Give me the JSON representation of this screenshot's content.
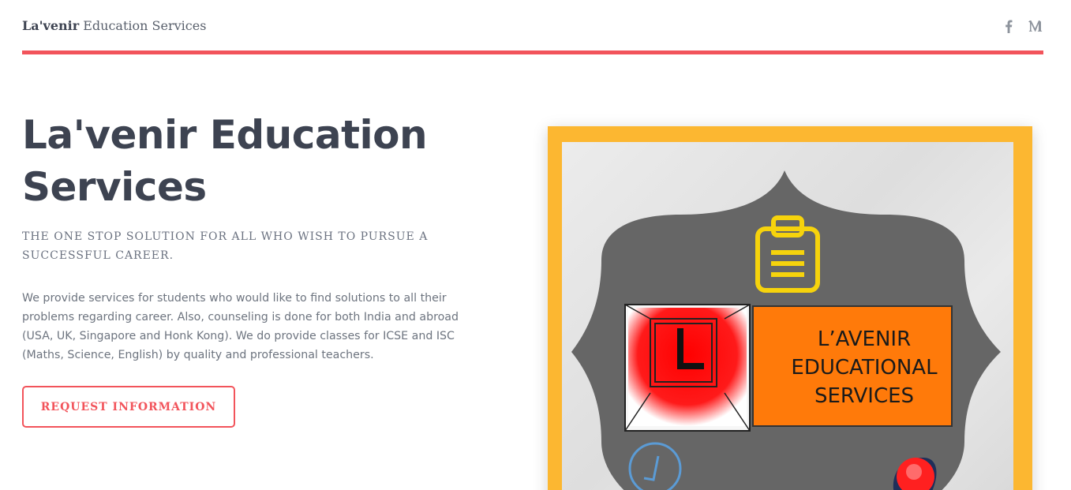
{
  "header": {
    "brand_bold": "La'venir",
    "brand_rest": "Education Services",
    "social": [
      {
        "name": "facebook-icon"
      },
      {
        "name": "medium-icon"
      }
    ],
    "accent_color": "#f2545b"
  },
  "hero": {
    "title": "La'venir Education Services",
    "subtitle": "THE ONE STOP SOLUTION FOR ALL WHO WISH TO PURSUE A SUCCESSFUL CAREER.",
    "description": "We provide services for students who would like to find solutions to all their problems regarding career. Also, counseling is done for both India and abroad (USA, UK, Singapore and Honk Kong). We do provide classes for ICSE and ISC (Maths, Science, English) by quality and professional teachers.",
    "cta_label": "REQUEST INFORMATION"
  },
  "poster": {
    "line1": "L’AVENIR",
    "line2": "EDUCATIONAL",
    "line3": "SERVICES",
    "logo_letter": "L",
    "frame_color": "#fcb731",
    "plaque_color": "#666666",
    "banner_color": "#ff7a0a"
  }
}
